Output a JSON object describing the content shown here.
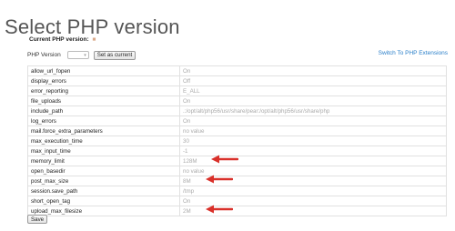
{
  "page": {
    "title": "Select PHP version"
  },
  "current_version": {
    "label": "Current PHP version:",
    "value": ""
  },
  "controls": {
    "php_version_label": "PHP Version",
    "version_select_value": "",
    "set_current_label": "Set as current",
    "extensions_link": "Switch To PHP Extensions"
  },
  "options": [
    {
      "name": "allow_url_fopen",
      "value": "On",
      "highlighted": false
    },
    {
      "name": "display_errors",
      "value": "Off",
      "highlighted": false
    },
    {
      "name": "error_reporting",
      "value": "E_ALL",
      "highlighted": false
    },
    {
      "name": "file_uploads",
      "value": "On",
      "highlighted": false
    },
    {
      "name": "include_path",
      "value": ".:/opt/alt/php56/usr/share/pear:/opt/alt/php56/usr/share/php",
      "highlighted": false
    },
    {
      "name": "log_errors",
      "value": "On",
      "highlighted": false
    },
    {
      "name": "mail.force_extra_parameters",
      "value": "no value",
      "highlighted": false
    },
    {
      "name": "max_execution_time",
      "value": "30",
      "highlighted": false
    },
    {
      "name": "max_input_time",
      "value": "-1",
      "highlighted": false
    },
    {
      "name": "memory_limit",
      "value": "128M",
      "highlighted": true
    },
    {
      "name": "open_basedir",
      "value": "no value",
      "highlighted": false
    },
    {
      "name": "post_max_size",
      "value": "8M",
      "highlighted": true
    },
    {
      "name": "session.save_path",
      "value": "/tmp",
      "highlighted": false
    },
    {
      "name": "short_open_tag",
      "value": "On",
      "highlighted": false
    },
    {
      "name": "upload_max_filesize",
      "value": "2M",
      "highlighted": true
    }
  ],
  "footer": {
    "save_label": "Save"
  },
  "colors": {
    "annotation_arrow": "#d9302a",
    "link": "#2a7fc9",
    "version_badge": "#d9a98a"
  }
}
